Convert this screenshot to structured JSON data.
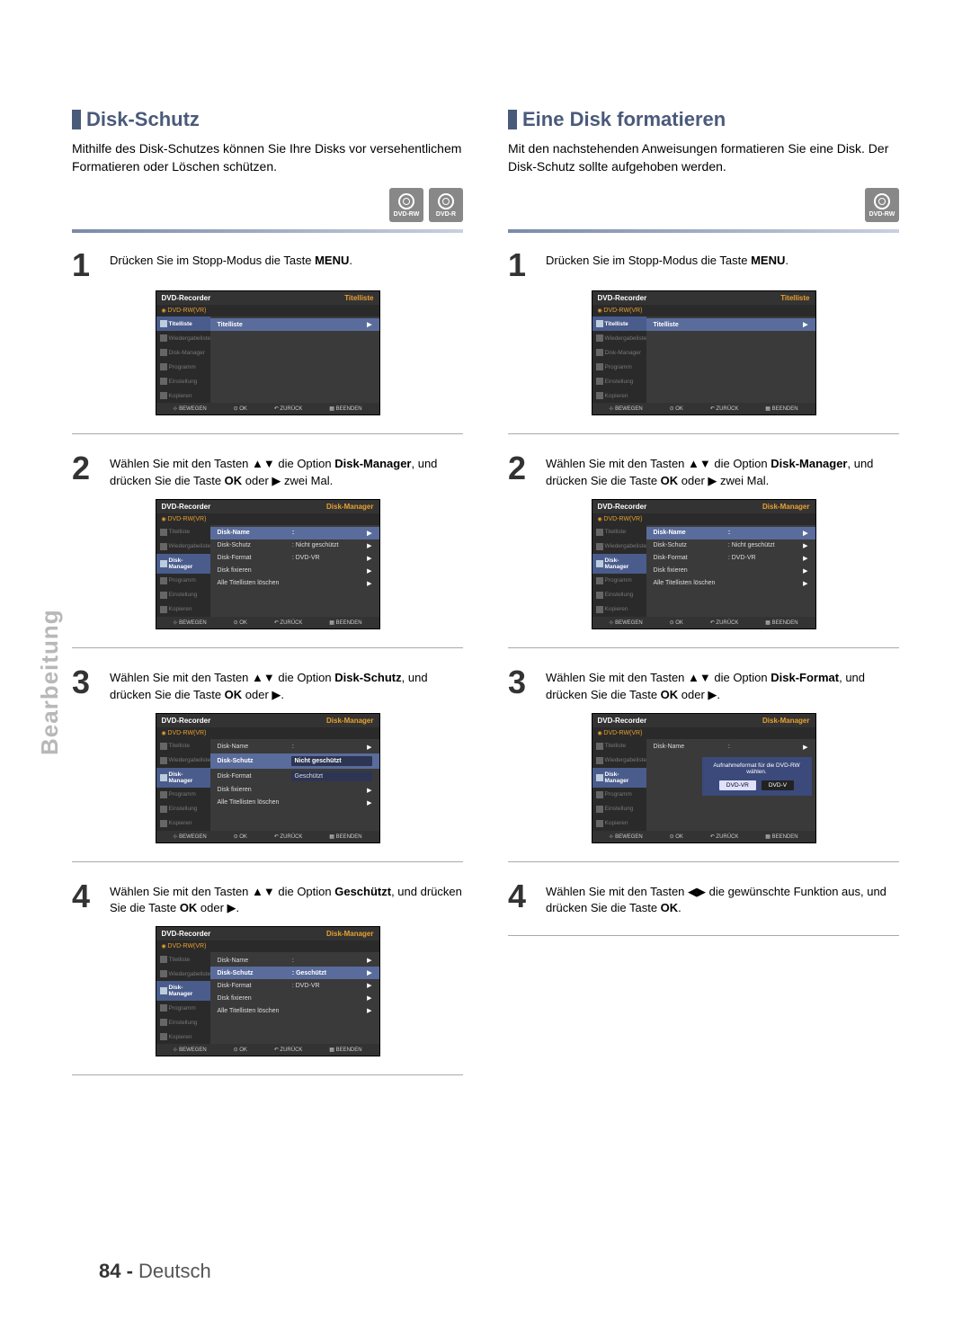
{
  "side_label": "Bearbeitung",
  "page_footer": {
    "num": "84 -",
    "lang": "Deutsch"
  },
  "disc_badges": {
    "rw": "DVD-RW",
    "r": "DVD-R"
  },
  "osd_common": {
    "title": "DVD-Recorder",
    "sub": "DVD-RW(VR)",
    "nav": [
      "Titelliste",
      "Wiedergabeliste",
      "Disk-Manager",
      "Programm",
      "Einstellung",
      "Kopieren"
    ],
    "footer_move": "BEWEGEN",
    "footer_ok": "OK",
    "footer_back": "ZURÜCK",
    "footer_exit": "BEENDEN",
    "heading_titelliste": "Titelliste",
    "heading_disk_manager": "Disk-Manager"
  },
  "left": {
    "title": "Disk-Schutz",
    "intro": "Mithilfe des Disk-Schutzes können Sie Ihre Disks vor versehentlichem Formatieren oder Löschen schützen.",
    "step1": {
      "pre": "Drücken Sie im Stopp-Modus die Taste ",
      "bold": "MENU",
      "post": "."
    },
    "step2": {
      "pre": "Wählen Sie mit den Tasten ▲▼ die Option ",
      "b1": "Disk-Manager",
      "mid": ", und drücken Sie die Taste ",
      "b2": "OK",
      "post": " oder ▶ zwei Mal."
    },
    "step3": {
      "pre": "Wählen Sie mit den Tasten ▲▼ die Option ",
      "b1": "Disk-Schutz",
      "mid": ", und drücken Sie die Taste ",
      "b2": "OK",
      "post": " oder ▶."
    },
    "step4": {
      "pre": "Wählen Sie mit den Tasten ▲▼ die Option ",
      "b1": "Geschützt",
      "mid": ", und drücken Sie die Taste ",
      "b2": "OK",
      "post": " oder ▶."
    },
    "osd1_main": [
      {
        "l": "Titelliste",
        "v": "",
        "a": "▶",
        "hl": true
      }
    ],
    "osd2_main": [
      {
        "l": "Disk-Name",
        "v": ":",
        "a": "▶",
        "hl": true
      },
      {
        "l": "Disk-Schutz",
        "v": ": Nicht geschützt",
        "a": "▶"
      },
      {
        "l": "Disk-Format",
        "v": ": DVD-VR",
        "a": "▶"
      },
      {
        "l": "Disk fixieren",
        "v": "",
        "a": "▶"
      },
      {
        "l": "Alle Titellisten löschen",
        "v": "",
        "a": "▶"
      }
    ],
    "osd3_main": [
      {
        "l": "Disk-Name",
        "v": ":",
        "a": "▶"
      },
      {
        "l": "Disk-Schutz",
        "v": "Nicht geschützt",
        "a": "",
        "hl": true,
        "box": true
      },
      {
        "l": "Disk-Format",
        "v": "Geschützt",
        "a": "",
        "box": true
      },
      {
        "l": "Disk fixieren",
        "v": "",
        "a": "▶"
      },
      {
        "l": "Alle Titellisten löschen",
        "v": "",
        "a": "▶"
      }
    ],
    "osd4_main": [
      {
        "l": "Disk-Name",
        "v": ":",
        "a": "▶"
      },
      {
        "l": "Disk-Schutz",
        "v": ": Geschützt",
        "a": "▶",
        "hl": true
      },
      {
        "l": "Disk-Format",
        "v": ": DVD-VR",
        "a": "▶"
      },
      {
        "l": "Disk fixieren",
        "v": "",
        "a": "▶"
      },
      {
        "l": "Alle Titellisten löschen",
        "v": "",
        "a": "▶"
      }
    ]
  },
  "right": {
    "title": "Eine Disk formatieren",
    "intro": "Mit den nachstehenden Anweisungen formatieren Sie eine Disk. Der Disk-Schutz sollte aufgehoben werden.",
    "step1": {
      "pre": "Drücken Sie im Stopp-Modus die Taste ",
      "bold": "MENU",
      "post": "."
    },
    "step2": {
      "pre": "Wählen Sie mit den Tasten ▲▼ die Option ",
      "b1": "Disk-Manager",
      "mid": ", und drücken Sie die Taste ",
      "b2": "OK",
      "post": " oder ▶ zwei Mal."
    },
    "step3": {
      "pre": "Wählen Sie mit den Tasten ▲▼ die Option ",
      "b1": "Disk-Format",
      "mid": ", und drücken Sie die Taste ",
      "b2": "OK",
      "post": " oder ▶."
    },
    "step4": {
      "pre": "Wählen Sie mit den Tasten ◀▶ die gewünschte Funktion aus, und drücken Sie die Taste ",
      "b1": "OK",
      "post": "."
    },
    "osd1_main": [
      {
        "l": "Titelliste",
        "v": "",
        "a": "▶",
        "hl": true
      }
    ],
    "osd2_main": [
      {
        "l": "Disk-Name",
        "v": ":",
        "a": "▶",
        "hl": true
      },
      {
        "l": "Disk-Schutz",
        "v": ": Nicht geschützt",
        "a": "▶"
      },
      {
        "l": "Disk-Format",
        "v": ": DVD-VR",
        "a": "▶"
      },
      {
        "l": "Disk fixieren",
        "v": "",
        "a": "▶"
      },
      {
        "l": "Alle Titellisten löschen",
        "v": "",
        "a": "▶"
      }
    ],
    "osd3_main_top": [
      {
        "l": "Disk-Name",
        "v": ":",
        "a": "▶"
      }
    ],
    "osd3_dialog": {
      "msg": "Aufnahmeformat für die DVD-RW wählen.",
      "btn1": "DVD-VR",
      "btn2": "DVD-V"
    }
  }
}
